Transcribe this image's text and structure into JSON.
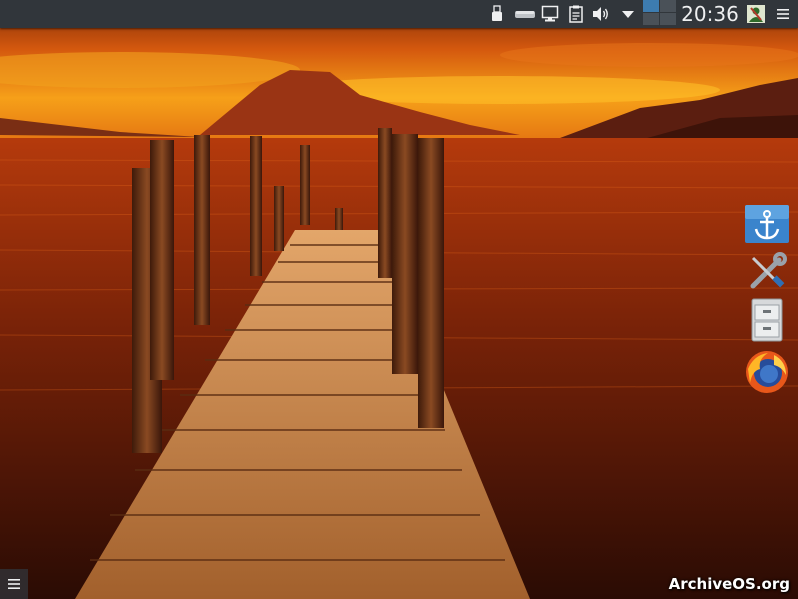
{
  "panel": {
    "clock": "20:36",
    "tray_icons": [
      "usb-device-icon",
      "disk-drive-icon",
      "network-icon",
      "clipboard-icon",
      "volume-icon",
      "tray-expand-icon"
    ],
    "pager": {
      "desktops": 4,
      "active": 1
    },
    "avatar_icon": "user-avatar-icon",
    "menu_icon": "hamburger-menu-icon"
  },
  "launcher": {
    "items": [
      {
        "icon": "anchor-icon"
      },
      {
        "icon": "tools-icon"
      },
      {
        "icon": "file-cabinet-icon"
      },
      {
        "icon": "firefox-icon"
      }
    ]
  },
  "bottom_left": {
    "icon": "application-menu-icon"
  },
  "watermark": "ArchiveOS.org",
  "colors": {
    "panel_bg": "#31363b",
    "pager_active": "#3d7cb0",
    "pager_inactive": "#4a5158",
    "text": "#eff0f1"
  }
}
